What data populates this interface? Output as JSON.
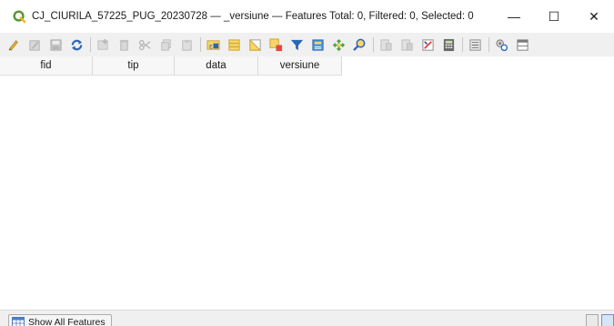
{
  "window": {
    "title": "CJ_CIURILA_57225_PUG_20230728 — _versiune — Features Total: 0, Filtered: 0, Selected: 0",
    "app_icon": "qgis-logo-icon",
    "controls": {
      "minimize": "—",
      "maximize": "☐",
      "close": "✕"
    }
  },
  "toolbar": {
    "buttons": [
      "toggle-editing-icon",
      "toggle-multi-edit-icon",
      "save-edits-icon",
      "reload-table-icon",
      "add-feature-icon",
      "delete-features-icon",
      "cut-features-icon",
      "copy-features-icon",
      "paste-features-icon",
      "select-by-expression-icon",
      "select-all-icon",
      "invert-selection-icon",
      "deselect-all-icon",
      "filter-select-icon",
      "move-selection-top-icon",
      "pan-to-selected-icon",
      "zoom-to-selected-icon",
      "new-field-icon",
      "delete-field-icon",
      "organize-columns-icon",
      "field-calculator-icon",
      "conditional-formatting-icon",
      "actions-icon",
      "dock-table-icon"
    ]
  },
  "table": {
    "columns": [
      "fid",
      "tip",
      "data",
      "versiune"
    ],
    "rows": []
  },
  "statusbar": {
    "filter_button_label": "Show All Features",
    "filter_icon": "table-icon",
    "view_buttons": [
      "form-view-icon",
      "table-view-icon"
    ]
  }
}
